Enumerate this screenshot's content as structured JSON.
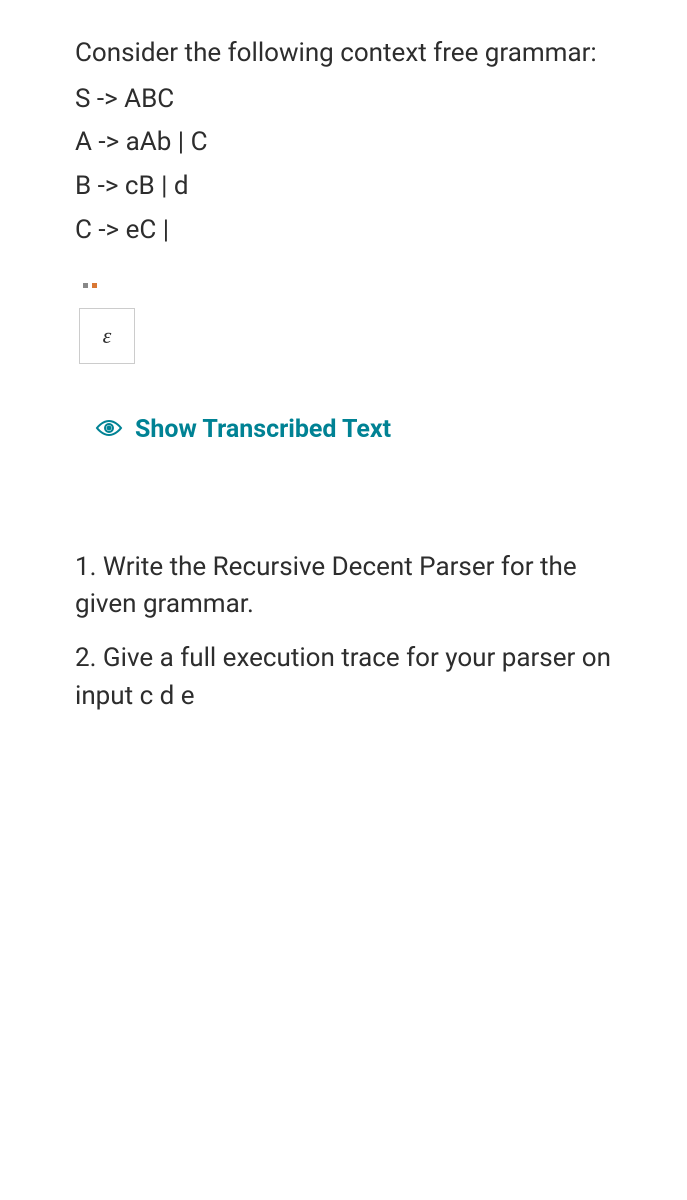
{
  "intro": "Consider the following context free grammar:",
  "grammar": {
    "rule1": "S -> ABC",
    "rule2": "A -> aAb | C",
    "rule3": "B -> cB | d",
    "rule4": "C -> eC |"
  },
  "epsilon": "ε",
  "transcribed_label": "Show Transcribed Text",
  "questions": {
    "q1": "1. Write the Recursive Decent Parser for the given grammar.",
    "q2": "2. Give a full execution trace for your parser on input c d e"
  }
}
